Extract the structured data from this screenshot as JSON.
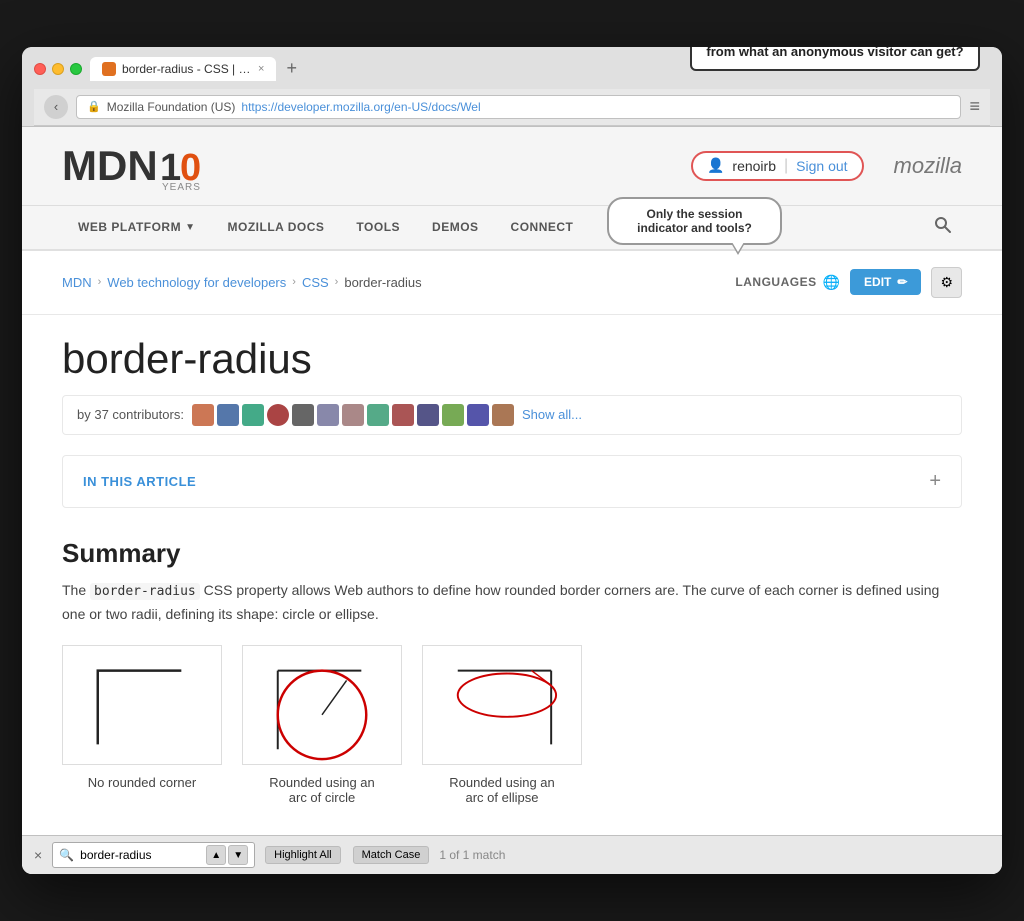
{
  "browser": {
    "tab_title": "border-radius - CSS | MDN",
    "tab_close": "×",
    "tab_new": "+",
    "url": "https://developer.mozilla.org/en-US/docs/Wel",
    "url_display": "https://developer.mozilla.org/en-US/docs/Wel",
    "back_arrow": "‹",
    "menu_icon": "≡"
  },
  "annotation_top": "What makes a  content site page unique\nfrom what an anonymous visitor can get?",
  "speech_bubble": "Only the session\nindicator and tools?",
  "mdn": {
    "logo": "MDN",
    "years": "10 YEARS",
    "mozilla": "mozilla",
    "user": {
      "icon": "👤",
      "name": "renoirb",
      "separator": "|",
      "signout": "Sign out"
    },
    "nav": {
      "items": [
        {
          "label": "WEB PLATFORM",
          "has_arrow": true
        },
        {
          "label": "MOZILLA DOCS"
        },
        {
          "label": "TOOLS"
        },
        {
          "label": "DEMOS"
        },
        {
          "label": "CONNECT"
        }
      ]
    },
    "breadcrumb": {
      "items": [
        {
          "label": "MDN",
          "link": true
        },
        {
          "label": "Web technology for developers",
          "link": true
        },
        {
          "label": "CSS",
          "link": true
        },
        {
          "label": "border-radius",
          "link": false
        }
      ]
    },
    "languages_label": "LANGUAGES",
    "edit_label": "EDIT",
    "settings_icon": "⚙",
    "article": {
      "title": "border-radius",
      "contributors_label": "by 37 contributors:",
      "show_all": "Show all...",
      "in_this_article": "IN THIS ARTICLE",
      "expand": "+",
      "summary_title": "Summary",
      "summary_text_parts": {
        "pre": "The ",
        "code": "border-radius",
        "post": " CSS property allows Web authors to define how rounded border corners are. The curve of each corner is defined using one or two radii, defining its shape: circle or ellipse."
      },
      "diagrams": [
        {
          "caption_line1": "No rounded corner",
          "caption_line2": ""
        },
        {
          "caption_line1": "Rounded using an",
          "caption_line2": "arc of circle"
        },
        {
          "caption_line1": "Rounded using an",
          "caption_line2": "arc of ellipse"
        }
      ]
    }
  },
  "find_bar": {
    "close": "×",
    "search_icon": "🔍",
    "query": "border-radius",
    "up_arrow": "▲",
    "down_arrow": "▼",
    "highlight_all": "Highlight All",
    "match_case": "Match Case",
    "match_count": "1 of 1 match"
  }
}
